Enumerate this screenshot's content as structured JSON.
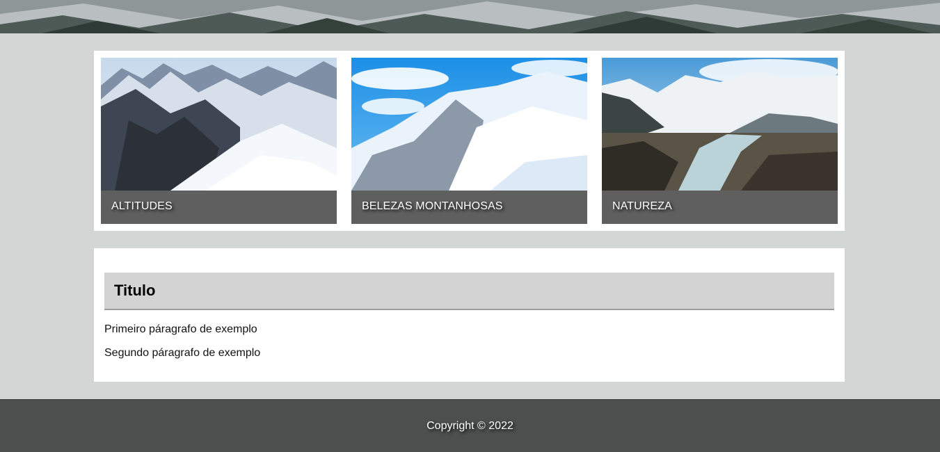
{
  "colors": {
    "page_background": "#d2d7d6",
    "caption_background": "#5f5f5f",
    "title_bar_background": "#d3d3d3",
    "footer_background": "#4d4f4e"
  },
  "gallery": {
    "cards": [
      {
        "caption": "ALTITUDES",
        "image": "snowy-mountain-ridge-with-climbers"
      },
      {
        "caption": "BELEZAS MONTANHOSAS",
        "image": "snowy-peak-blue-sky"
      },
      {
        "caption": "NATUREZA",
        "image": "mountain-valley-with-river"
      }
    ]
  },
  "article": {
    "title": "Titulo",
    "paragraphs": [
      "Primeiro páragrafo de exemplo",
      "Segundo páragrafo de exemplo"
    ]
  },
  "footer": {
    "copyright": "Copyright © 2022"
  }
}
